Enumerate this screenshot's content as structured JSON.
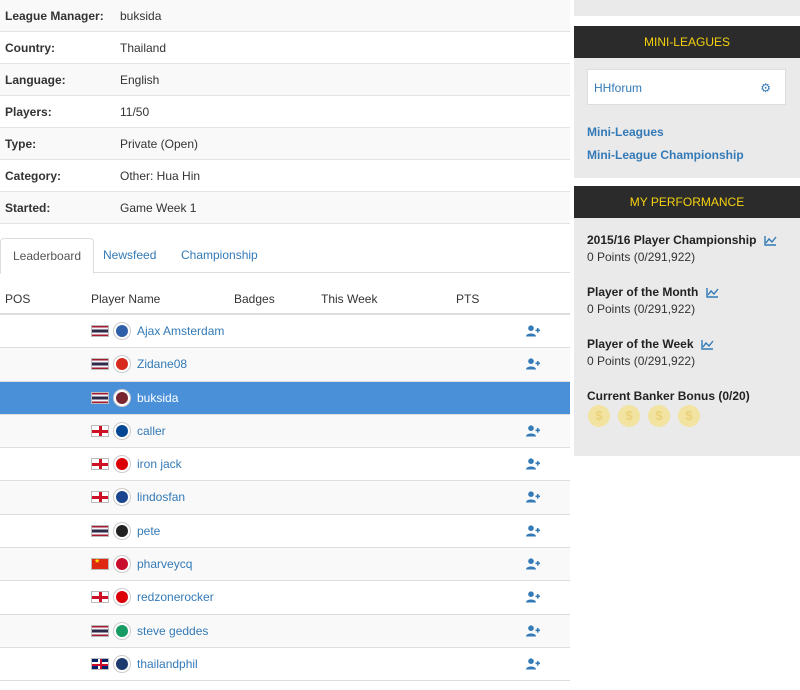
{
  "info": [
    {
      "label": "League Manager:",
      "value": "buksida"
    },
    {
      "label": "Country:",
      "value": "Thailand"
    },
    {
      "label": "Language:",
      "value": "English"
    },
    {
      "label": "Players:",
      "value": "11/50"
    },
    {
      "label": "Type:",
      "value": "Private (Open)"
    },
    {
      "label": "Category:",
      "value": "Other: Hua Hin"
    },
    {
      "label": "Started:",
      "value": "Game Week 1"
    }
  ],
  "tabs": [
    "Leaderboard",
    "Newsfeed",
    "Championship"
  ],
  "columns": [
    "POS",
    "Player Name",
    "Badges",
    "This Week",
    "PTS"
  ],
  "players": [
    {
      "name": "Ajax Amsterdam",
      "flag": "th",
      "badge_color": "#2f5fa8",
      "add": true
    },
    {
      "name": "Zidane08",
      "flag": "th",
      "badge_color": "#d62a1e",
      "add": true
    },
    {
      "name": "buksida",
      "flag": "th",
      "badge_color": "#7a2631",
      "add": false
    },
    {
      "name": "caller",
      "flag": "en",
      "badge_color": "#034694",
      "add": true
    },
    {
      "name": "iron jack",
      "flag": "en",
      "badge_color": "#db0007",
      "add": true
    },
    {
      "name": "lindosfan",
      "flag": "en",
      "badge_color": "#1b458f",
      "add": true
    },
    {
      "name": "pete",
      "flag": "th",
      "badge_color": "#222222",
      "add": true
    },
    {
      "name": "pharveycq",
      "flag": "cn",
      "badge_color": "#c8102e",
      "add": true
    },
    {
      "name": "redzonerocker",
      "flag": "en",
      "badge_color": "#db0007",
      "add": true
    },
    {
      "name": "steve geddes",
      "flag": "th",
      "badge_color": "#169b62",
      "add": true
    },
    {
      "name": "thailandphil",
      "flag": "gb",
      "badge_color": "#1d3b6e",
      "add": true
    }
  ],
  "sidebar": {
    "mini_leagues_title": "MINI-LEAGUES",
    "mini_league_item": "HHforum",
    "link_mini_leagues": "Mini-Leagues",
    "link_championship": "Mini-League Championship",
    "performance_title": "MY PERFORMANCE",
    "perf": [
      {
        "title": "2015/16 Player Championship",
        "value": "0 Points (0/291,922)"
      },
      {
        "title": "Player of the Month",
        "value": "0 Points (0/291,922)"
      },
      {
        "title": "Player of the Week",
        "value": "0 Points (0/291,922)"
      }
    ],
    "banker_title": "Current Banker Bonus (0/20)",
    "coin_symbol": "$"
  },
  "colors": {
    "accent": "#337ab7",
    "highlight": "#4a90d9",
    "header_bg": "#2b2b2b",
    "header_text": "#f5d20f"
  }
}
